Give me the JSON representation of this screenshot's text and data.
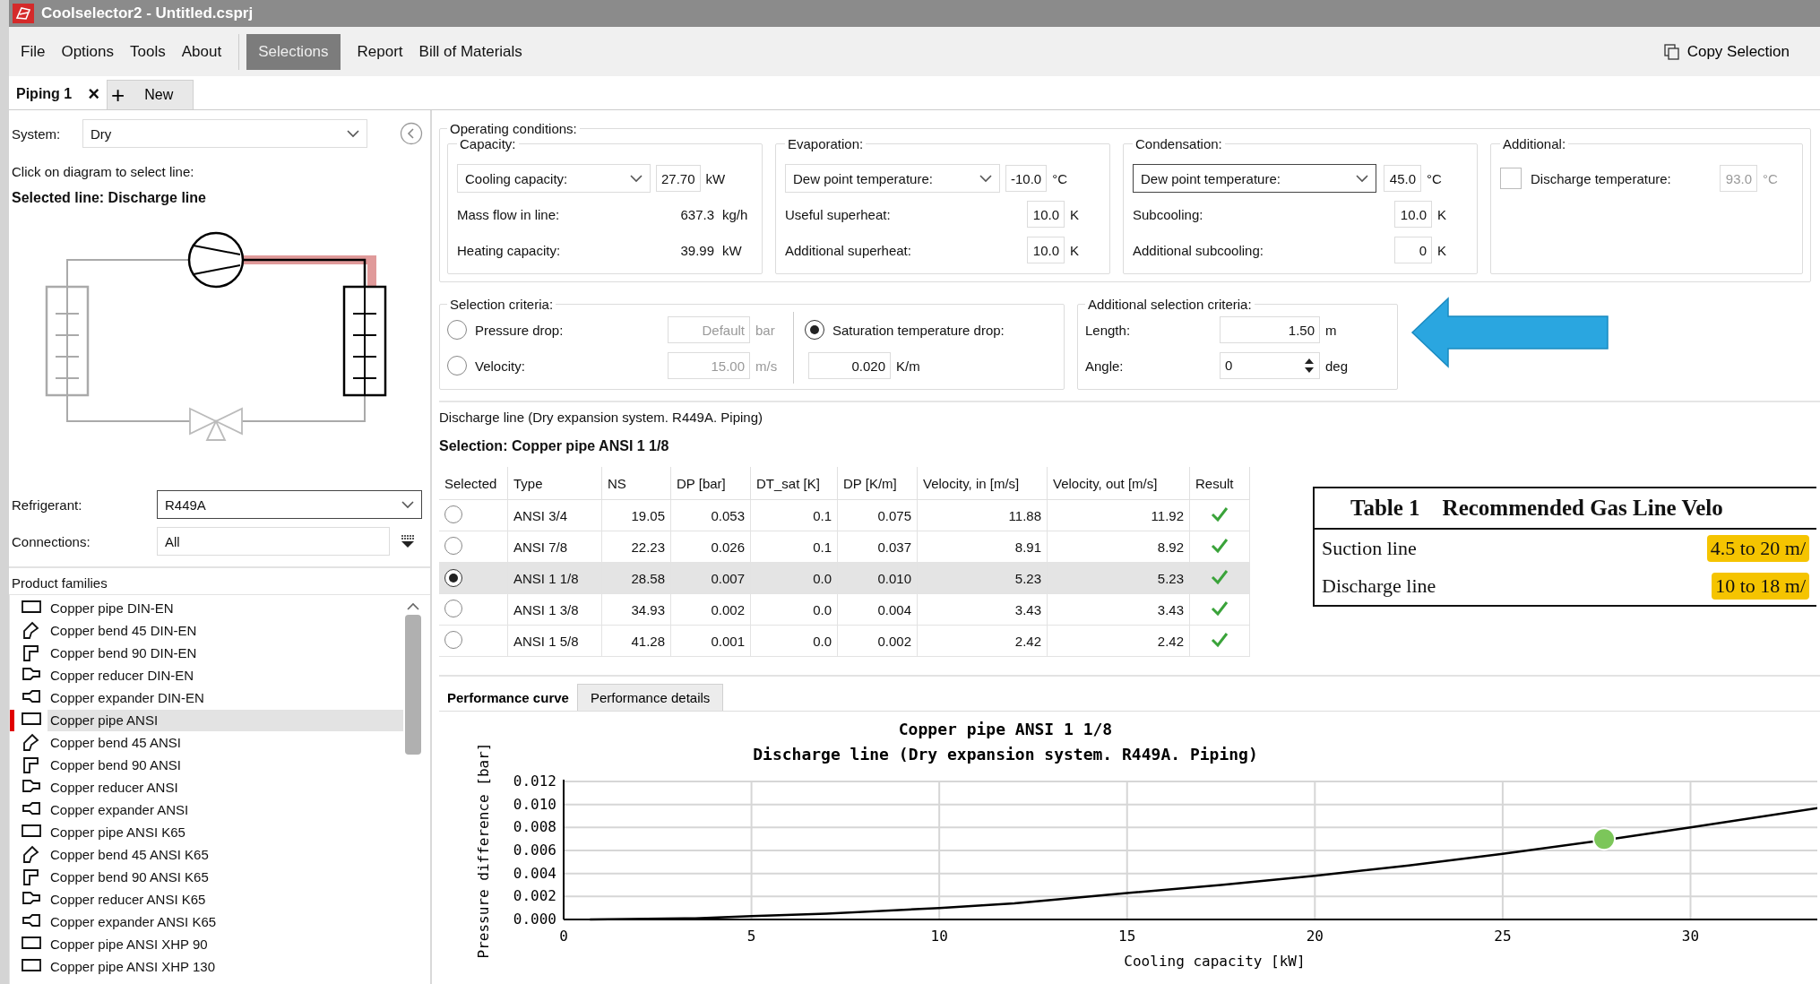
{
  "window": {
    "title": "Coolselector2 - Untitled.csprj"
  },
  "menu": [
    {
      "label": "File",
      "selected": false
    },
    {
      "label": "Options",
      "selected": false
    },
    {
      "label": "Tools",
      "selected": false
    },
    {
      "label": "About",
      "selected": false
    },
    {
      "label": "Selections",
      "selected": true
    },
    {
      "label": "Report",
      "selected": false
    },
    {
      "label": "Bill of Materials",
      "selected": false
    }
  ],
  "copy_button": "Copy Selection",
  "tabs": [
    {
      "label": "Piping 1",
      "selected": true,
      "close": "×"
    }
  ],
  "new_tab": {
    "icon": "+",
    "label": "New"
  },
  "left": {
    "system": {
      "label": "System:",
      "value": "Dry"
    },
    "hint": "Click on diagram to select line:",
    "selected_line": "Selected line: Discharge line",
    "refrigerant": {
      "label": "Refrigerant:",
      "value": "R449A"
    },
    "connections": {
      "label": "Connections:",
      "value": "All"
    },
    "families_title": "Product families",
    "families": [
      {
        "label": "Copper pipe DIN-EN",
        "kind": "pipe",
        "selected": false
      },
      {
        "label": "Copper bend 45 DIN-EN",
        "kind": "bend45",
        "selected": false
      },
      {
        "label": "Copper bend 90 DIN-EN",
        "kind": "bend90",
        "selected": false
      },
      {
        "label": "Copper reducer DIN-EN",
        "kind": "reducer",
        "selected": false
      },
      {
        "label": "Copper expander DIN-EN",
        "kind": "expander",
        "selected": false
      },
      {
        "label": "Copper pipe ANSI",
        "kind": "pipe",
        "selected": true
      },
      {
        "label": "Copper bend 45 ANSI",
        "kind": "bend45",
        "selected": false
      },
      {
        "label": "Copper bend 90 ANSI",
        "kind": "bend90",
        "selected": false
      },
      {
        "label": "Copper reducer ANSI",
        "kind": "reducer",
        "selected": false
      },
      {
        "label": "Copper expander ANSI",
        "kind": "expander",
        "selected": false
      },
      {
        "label": "Copper pipe ANSI K65",
        "kind": "pipe",
        "selected": false
      },
      {
        "label": "Copper bend 45 ANSI K65",
        "kind": "bend45",
        "selected": false
      },
      {
        "label": "Copper bend 90 ANSI K65",
        "kind": "bend90",
        "selected": false
      },
      {
        "label": "Copper reducer ANSI K65",
        "kind": "reducer",
        "selected": false
      },
      {
        "label": "Copper expander ANSI K65",
        "kind": "expander",
        "selected": false
      },
      {
        "label": "Copper pipe ANSI XHP 90",
        "kind": "pipe",
        "selected": false
      },
      {
        "label": "Copper pipe ANSI XHP 130",
        "kind": "pipe",
        "selected": false
      }
    ]
  },
  "operating_conditions": {
    "title": "Operating conditions:",
    "groups": [
      {
        "title": "Capacity:",
        "rows": [
          {
            "kind": "select",
            "label": "Cooling capacity:",
            "value": "27.70",
            "unit": "kW",
            "focused": false
          },
          {
            "kind": "readout",
            "label": "Mass flow in line:",
            "value": "637.3",
            "unit": "kg/h"
          },
          {
            "kind": "readout",
            "label": "Heating capacity:",
            "value": "39.99",
            "unit": "kW"
          }
        ]
      },
      {
        "title": "Evaporation:",
        "rows": [
          {
            "kind": "select",
            "label": "Dew point temperature:",
            "value": "-10.0",
            "unit": "°C",
            "focused": false
          },
          {
            "kind": "input",
            "label": "Useful superheat:",
            "value": "10.0",
            "unit": "K"
          },
          {
            "kind": "input",
            "label": "Additional superheat:",
            "value": "10.0",
            "unit": "K"
          }
        ]
      },
      {
        "title": "Condensation:",
        "rows": [
          {
            "kind": "select",
            "label": "Dew point temperature:",
            "value": "45.0",
            "unit": "°C",
            "focused": true
          },
          {
            "kind": "input",
            "label": "Subcooling:",
            "value": "10.0",
            "unit": "K"
          },
          {
            "kind": "input",
            "label": "Additional subcooling:",
            "value": "0",
            "unit": "K"
          }
        ]
      },
      {
        "title": "Additional:",
        "rows": [
          {
            "kind": "checkbox",
            "label": "Discharge temperature:",
            "value": "93.0",
            "unit": "°C",
            "checked": false
          }
        ]
      }
    ]
  },
  "selection_criteria": {
    "title": "Selection criteria:",
    "options": [
      {
        "label": "Pressure drop:",
        "value": "Default",
        "unit": "bar",
        "selected": false,
        "disabled": true
      },
      {
        "label": "Velocity:",
        "value": "15.00",
        "unit": "m/s",
        "selected": false,
        "disabled": true
      },
      {
        "label": "Saturation temperature drop:",
        "value": "0.020",
        "unit": "K/m",
        "selected": true,
        "disabled": false
      }
    ]
  },
  "additional_criteria": {
    "title": "Additional selection criteria:",
    "rows": [
      {
        "kind": "input",
        "label": "Length:",
        "value": "1.50",
        "unit": "m"
      },
      {
        "kind": "spin",
        "label": "Angle:",
        "value": "0",
        "unit": "deg"
      }
    ]
  },
  "result": {
    "description": "Discharge line (Dry expansion system. R449A. Piping)",
    "selection": "Selection: Copper pipe ANSI 1 1/8"
  },
  "table": {
    "columns": [
      "Selected",
      "Type",
      "NS",
      "DP [bar]",
      "DT_sat [K]",
      "DP [K/m]",
      "Velocity, in [m/s]",
      "Velocity, out [m/s]",
      "Result"
    ],
    "rows": [
      {
        "selected": false,
        "cells": [
          "",
          "ANSI 3/4",
          "19.05",
          "0.053",
          "0.1",
          "0.075",
          "11.88",
          "11.92"
        ],
        "ok": true
      },
      {
        "selected": false,
        "cells": [
          "",
          "ANSI 7/8",
          "22.23",
          "0.026",
          "0.1",
          "0.037",
          "8.91",
          "8.92"
        ],
        "ok": true
      },
      {
        "selected": true,
        "cells": [
          "",
          "ANSI 1 1/8",
          "28.58",
          "0.007",
          "0.0",
          "0.010",
          "5.23",
          "5.23"
        ],
        "ok": true
      },
      {
        "selected": false,
        "cells": [
          "",
          "ANSI 1 3/8",
          "34.93",
          "0.002",
          "0.0",
          "0.004",
          "3.43",
          "3.43"
        ],
        "ok": true
      },
      {
        "selected": false,
        "cells": [
          "",
          "ANSI 1 5/8",
          "41.28",
          "0.001",
          "0.0",
          "0.002",
          "2.42",
          "2.42"
        ],
        "ok": true
      }
    ]
  },
  "reference_table": {
    "title": "Table 1    Recommended Gas Line Velo",
    "rows": [
      {
        "label": "Suction line",
        "value": "4.5 to 20 m/"
      },
      {
        "label": "Discharge line",
        "value": "10 to 18 m/"
      }
    ]
  },
  "bottom_tabs": [
    {
      "label": "Performance curve",
      "selected": true
    },
    {
      "label": "Performance details",
      "selected": false
    }
  ],
  "chart_data": {
    "type": "line",
    "title": "Copper pipe ANSI 1 1/8",
    "subtitle": "Discharge line (Dry expansion system. R449A. Piping)",
    "xlabel": "Cooling capacity [kW]",
    "ylabel": "Pressure difference [bar]",
    "x": [
      0.7,
      3.5,
      5,
      7,
      10,
      12,
      15,
      17.5,
      20,
      22.5,
      25,
      27.7,
      30,
      33.4
    ],
    "grid": true,
    "series": [
      {
        "color": "#000000",
        "values": [
          0.0,
          0.0001,
          0.0003,
          0.0005,
          0.001,
          0.0014,
          0.0023,
          0.003,
          0.0038,
          0.0047,
          0.0057,
          0.0069,
          0.008,
          0.0097
        ]
      }
    ],
    "xlim": [
      0,
      33.4
    ],
    "ylim": [
      0,
      0.012
    ],
    "xticks": [
      0,
      5,
      10,
      15,
      20,
      25,
      30
    ],
    "yticks": [
      {
        "value": 0,
        "label": "0.000"
      },
      {
        "value": 0.002,
        "label": "0.002"
      },
      {
        "value": 0.004,
        "label": "0.004"
      },
      {
        "value": 0.006,
        "label": "0.006"
      },
      {
        "value": 0.008,
        "label": "0.008"
      },
      {
        "value": 0.01,
        "label": "0.010"
      },
      {
        "value": 0.012,
        "label": "0.012"
      }
    ]
  }
}
